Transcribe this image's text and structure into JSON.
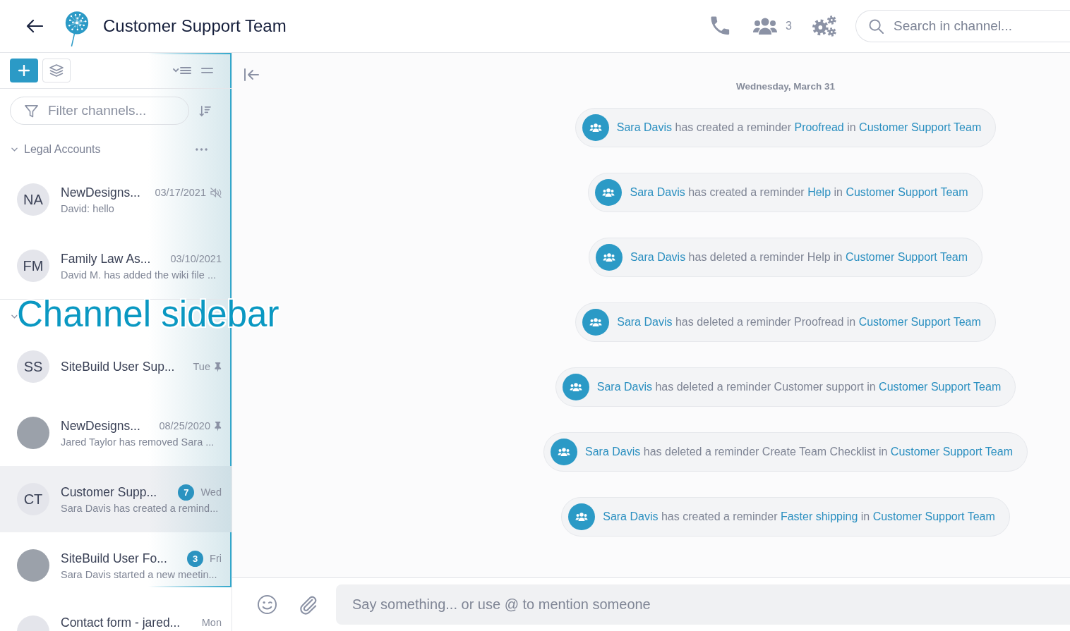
{
  "header": {
    "title": "Customer Support Team",
    "member_count": "3",
    "search": {
      "placeholder": "Search in channel..."
    }
  },
  "sidebar": {
    "filter": {
      "placeholder": "Filter channels..."
    },
    "groups": [
      {
        "label": "Legal Accounts",
        "expanded": true,
        "menu": true,
        "channels": [
          {
            "avatar": {
              "kind": "initials",
              "text": "NA"
            },
            "name": "NewDesigns...",
            "time": "03/17/2021",
            "preview": "David: hello",
            "muted": true,
            "pinned": false,
            "selected": false
          },
          {
            "avatar": {
              "kind": "initials",
              "text": "FM"
            },
            "name": "Family Law As...",
            "time": "03/10/2021",
            "preview": "David M. has added the wiki file ...",
            "muted": false,
            "pinned": false,
            "selected": false
          }
        ]
      },
      {
        "expanded": true,
        "menu": false,
        "channels": [
          {
            "avatar": {
              "kind": "initials",
              "text": "SS"
            },
            "name": "SiteBuild User Sup...",
            "time": "Tue",
            "muted": false,
            "pinned": true,
            "selected": false
          },
          {
            "avatar": {
              "kind": "photo"
            },
            "name": "NewDesigns...",
            "time": "08/25/2020",
            "preview": "Jared Taylor has removed Sara ...",
            "muted": false,
            "pinned": true,
            "selected": false
          },
          {
            "avatar": {
              "kind": "initials",
              "text": "CT"
            },
            "name": "Customer Supp...",
            "unread": "7",
            "time": "Wed",
            "preview": "Sara Davis has created a remind...",
            "muted": false,
            "pinned": false,
            "selected": true
          },
          {
            "avatar": {
              "kind": "photo"
            },
            "name": "SiteBuild User Fo...",
            "unread": "3",
            "time": "Fri",
            "preview": "Sara Davis started a new meetin...",
            "muted": false,
            "pinned": false,
            "selected": false
          },
          {
            "avatar": {
              "kind": "initials"
            },
            "name": "Contact form - jared...",
            "time": "Mon",
            "muted": false,
            "pinned": false,
            "selected": false
          }
        ]
      }
    ]
  },
  "chat": {
    "date": "Wednesday, March 31",
    "events": [
      {
        "segments": [
          {
            "kind": "user",
            "text": "Sara Davis"
          },
          {
            "kind": "text",
            "text": "has created a reminder"
          },
          {
            "kind": "reminder",
            "text": "Proofread"
          },
          {
            "kind": "text",
            "text": "in"
          },
          {
            "kind": "channel",
            "text": "Customer Support Team"
          }
        ]
      },
      {
        "segments": [
          {
            "kind": "user",
            "text": "Sara Davis"
          },
          {
            "kind": "text",
            "text": "has created a reminder"
          },
          {
            "kind": "reminder",
            "text": "Help"
          },
          {
            "kind": "text",
            "text": "in"
          },
          {
            "kind": "channel",
            "text": "Customer Support Team"
          }
        ]
      },
      {
        "segments": [
          {
            "kind": "user",
            "text": "Sara Davis"
          },
          {
            "kind": "text",
            "text": "has deleted a reminder Help in"
          },
          {
            "kind": "channel",
            "text": "Customer Support Team"
          }
        ]
      },
      {
        "segments": [
          {
            "kind": "user",
            "text": "Sara Davis"
          },
          {
            "kind": "text",
            "text": "has deleted a reminder Proofread in"
          },
          {
            "kind": "channel",
            "text": "Customer Support Team"
          }
        ]
      },
      {
        "segments": [
          {
            "kind": "user",
            "text": "Sara Davis"
          },
          {
            "kind": "text",
            "text": "has deleted a reminder Customer support in"
          },
          {
            "kind": "channel",
            "text": "Customer Support Team"
          }
        ]
      },
      {
        "segments": [
          {
            "kind": "user",
            "text": "Sara Davis"
          },
          {
            "kind": "text",
            "text": "has deleted a reminder Create Team Checklist in"
          },
          {
            "kind": "channel",
            "text": "Customer Support Team"
          }
        ]
      },
      {
        "segments": [
          {
            "kind": "user",
            "text": "Sara Davis"
          },
          {
            "kind": "text",
            "text": "has created a reminder"
          },
          {
            "kind": "reminder",
            "text": "Faster shipping"
          },
          {
            "kind": "text",
            "text": "in"
          },
          {
            "kind": "channel",
            "text": "Customer Support Team"
          }
        ]
      }
    ],
    "composer": {
      "placeholder": "Say something... or use @ to mention someone"
    }
  },
  "annotation": {
    "label": "Channel sidebar"
  }
}
